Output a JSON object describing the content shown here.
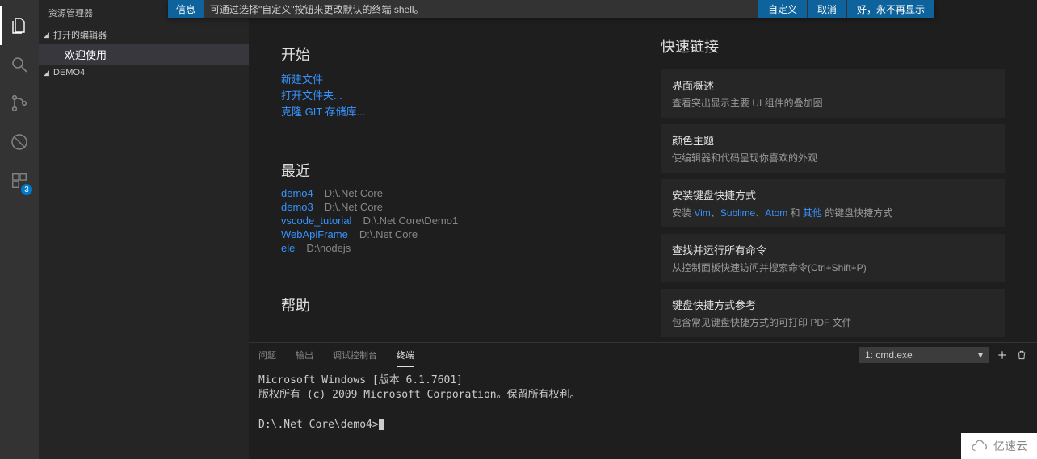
{
  "notification": {
    "badge": "信息",
    "text": "可通过选择\"自定义\"按钮来更改默认的终端 shell。",
    "actions": [
      "自定义",
      "取消",
      "好，永不再显示"
    ]
  },
  "activity": {
    "extensions_badge": "3"
  },
  "sidebar": {
    "title": "资源管理器",
    "open_editors_label": "打开的编辑器",
    "open_item": "欢迎使用",
    "folder_name": "DEMO4"
  },
  "welcome": {
    "start_label": "开始",
    "start_links": [
      "新建文件",
      "打开文件夹...",
      "克隆 GIT 存储库..."
    ],
    "recent_label": "最近",
    "recent": [
      {
        "name": "demo4",
        "path": "D:\\.Net Core"
      },
      {
        "name": "demo3",
        "path": "D:\\.Net Core"
      },
      {
        "name": "vscode_tutorial",
        "path": "D:\\.Net Core\\Demo1"
      },
      {
        "name": "WebApiFrame",
        "path": "D:\\.Net Core"
      },
      {
        "name": "ele",
        "path": "D:\\nodejs"
      }
    ],
    "help_label": "帮助"
  },
  "quicklinks": {
    "title": "快速链接",
    "cards": [
      {
        "title": "界面概述",
        "desc": "查看突出显示主要 UI 组件的叠加图"
      },
      {
        "title": "颜色主题",
        "desc": "使编辑器和代码呈现你喜欢的外观"
      },
      {
        "title": "安装键盘快捷方式",
        "desc_pre": "安装 ",
        "k1": "Vim",
        "sep1": "、",
        "k2": "Sublime",
        "sep2": "、",
        "k3": "Atom",
        "sep3": " 和 ",
        "k4": "其他",
        "desc_post": " 的键盘快捷方式"
      },
      {
        "title": "查找并运行所有命令",
        "desc": "从控制面板快速访问并搜索命令(Ctrl+Shift+P)"
      },
      {
        "title": "键盘快捷方式参考",
        "desc": "包含常见键盘快捷方式的可打印 PDF 文件"
      }
    ]
  },
  "panel": {
    "tabs": [
      "问题",
      "输出",
      "调试控制台",
      "终端"
    ],
    "active_tab": 3,
    "terminal_select": "1: cmd.exe",
    "terminal_lines": [
      "Microsoft Windows [版本 6.1.7601]",
      "版权所有 (c) 2009 Microsoft Corporation。保留所有权利。",
      "",
      "D:\\.Net Core\\demo4>"
    ]
  },
  "watermark": "亿速云"
}
